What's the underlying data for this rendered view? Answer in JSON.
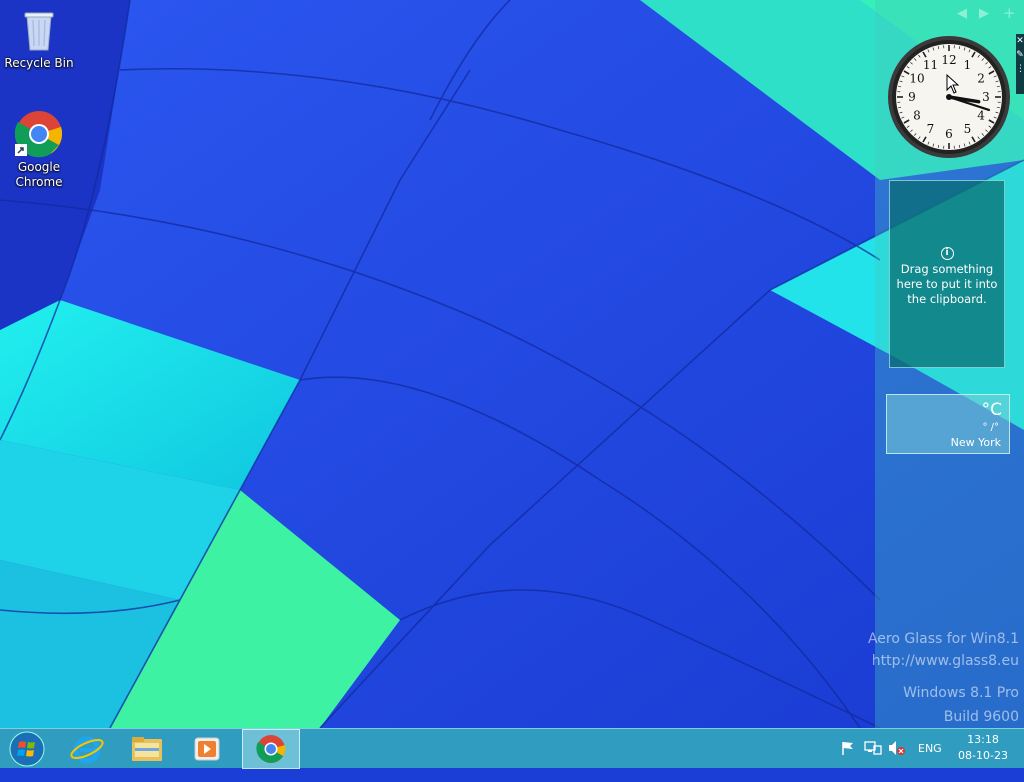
{
  "desktop": {
    "icons": [
      {
        "label": "Recycle Bin",
        "icon": "recycle-bin-icon"
      },
      {
        "label": "Google Chrome",
        "icon": "chrome-icon"
      }
    ]
  },
  "sidebar": {
    "controls": [
      "◀",
      "▶",
      "+"
    ],
    "clock": {
      "hour": 3,
      "minute": 18,
      "numerals": [
        "12",
        "1",
        "2",
        "3",
        "4",
        "5",
        "6",
        "7",
        "8",
        "9",
        "10",
        "11"
      ]
    },
    "clipboard": {
      "message": "Drag something here to put it into the clipboard."
    },
    "weather": {
      "temp": "°C",
      "range": "° /°",
      "city": "New York"
    }
  },
  "watermark": {
    "line1": "Aero Glass for Win8.1",
    "line2": "http://www.glass8.eu",
    "line3": "Windows 8.1 Pro",
    "line4": "Build 9600"
  },
  "taskbar": {
    "apps": [
      "start-orb-icon",
      "internet-explorer-icon",
      "file-explorer-icon",
      "media-player-icon",
      "chrome-icon"
    ],
    "tray": {
      "language": "ENG",
      "time": "13:18",
      "date": "08-10-23"
    }
  },
  "colors": {
    "wallpaper_blue": "#1b3fd6",
    "wallpaper_cyan": "#19e0e6",
    "wallpaper_green": "#3cf0b0",
    "taskbar": "#32a5be"
  }
}
